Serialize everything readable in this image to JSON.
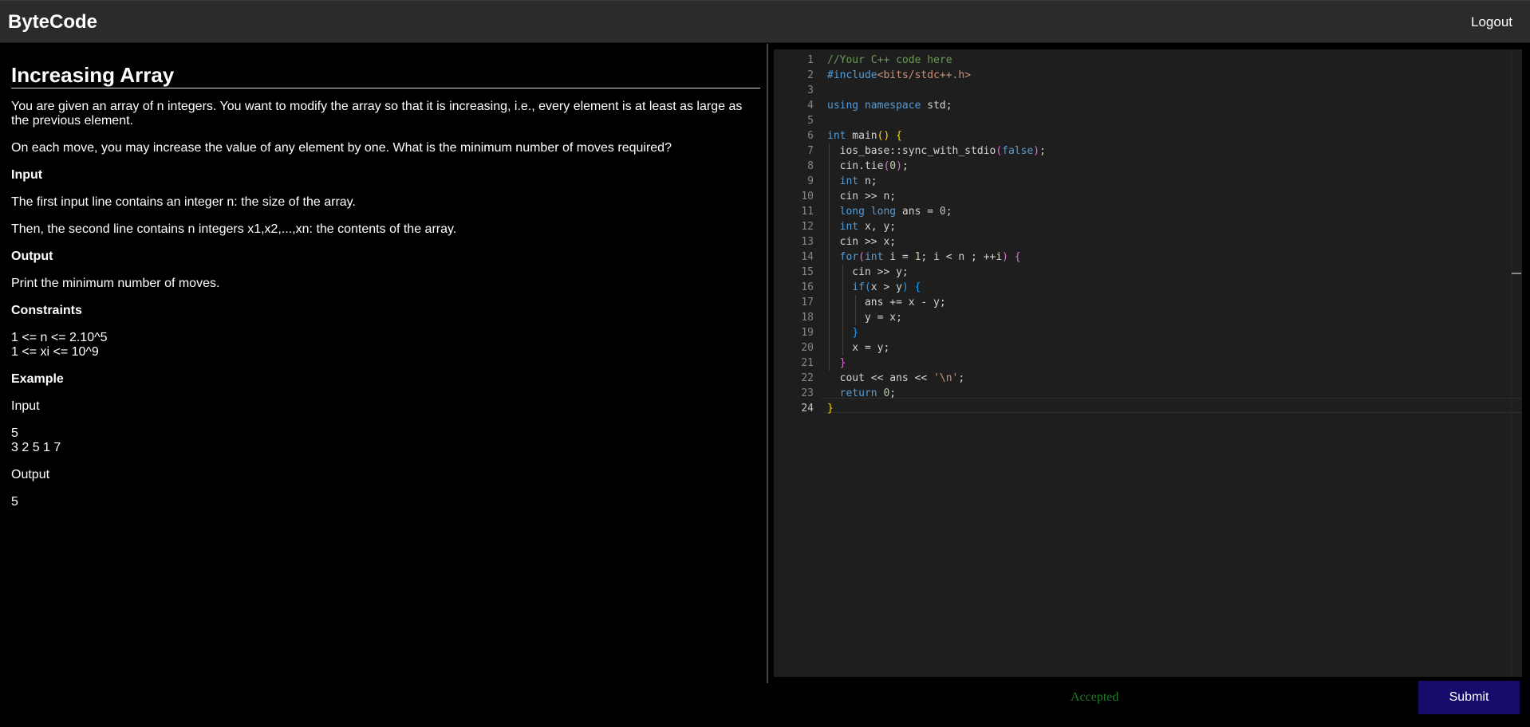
{
  "header": {
    "brand": "ByteCode",
    "logout": "Logout"
  },
  "problem": {
    "title": "Increasing Array",
    "paragraphs": [
      "You are given an array of n integers. You want to modify the array so that it is increasing, i.e., every element is at least as large as the previous element.",
      "On each move, you may increase the value of any element by one. What is the minimum number of moves required?"
    ],
    "input_heading": "Input",
    "input_lines": [
      "The first input line contains an integer n: the size of the array.",
      "Then, the second line contains n integers x1,x2,...,xn: the contents of the array."
    ],
    "output_heading": "Output",
    "output_text": "Print the minimum number of moves.",
    "constraints_heading": "Constraints",
    "constraints": [
      "1 <= n <= 2.10^5",
      "1 <= xi <= 10^9"
    ],
    "example_heading": "Example",
    "example_input_label": "Input",
    "example_input": [
      "5",
      "3 2 5 1 7"
    ],
    "example_output_label": "Output",
    "example_output": "5"
  },
  "editor": {
    "line_numbers": [
      "1",
      "2",
      "3",
      "4",
      "5",
      "6",
      "7",
      "8",
      "9",
      "10",
      "11",
      "12",
      "13",
      "14",
      "15",
      "16",
      "17",
      "18",
      "19",
      "20",
      "21",
      "22",
      "23",
      "24"
    ],
    "current_line": "24",
    "lines": [
      "//Your C++ code here",
      "#include<bits/stdc++.h>",
      "",
      "using namespace std;",
      "",
      "int main() {",
      "  ios_base::sync_with_stdio(false);",
      "  cin.tie(0);",
      "  int n;",
      "  cin >> n;",
      "  long long ans = 0;",
      "  int x, y;",
      "  cin >> x;",
      "  for(int i = 1; i < n ; ++i) {",
      "    cin >> y;",
      "    if(x > y) {",
      "      ans += x - y;",
      "      y = x;",
      "    }",
      "    x = y;",
      "  }",
      "  cout << ans << '\\n';",
      "  return 0;",
      "}"
    ]
  },
  "footer": {
    "status": "Accepted",
    "status_color": "#1f7a2a",
    "submit": "Submit"
  }
}
